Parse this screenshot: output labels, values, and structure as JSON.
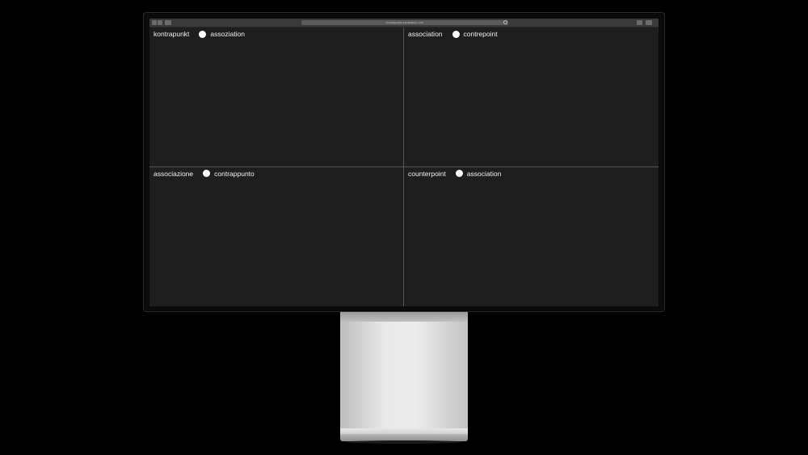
{
  "browser": {
    "url": "kontrapunkt-assoziation.com"
  },
  "quadrants": [
    {
      "left_word": "kontrapunkt",
      "right_word": "assoziation"
    },
    {
      "left_word": "association",
      "right_word": "contrepoint"
    },
    {
      "left_word": "associazione",
      "right_word": "contrappunto"
    },
    {
      "left_word": "counterpoint",
      "right_word": "association"
    }
  ],
  "icons": {
    "back": "chevron-left-icon",
    "forward": "chevron-right-icon",
    "sidebar": "sidebar-icon",
    "reload": "reload-icon",
    "share": "share-icon",
    "tabs": "tabs-icon",
    "dot": "circle-dot-icon"
  },
  "colors": {
    "screen_background": "#1e1e1e",
    "text": "#f2f2f2",
    "dot": "#ffffff",
    "divider": "#555555"
  }
}
